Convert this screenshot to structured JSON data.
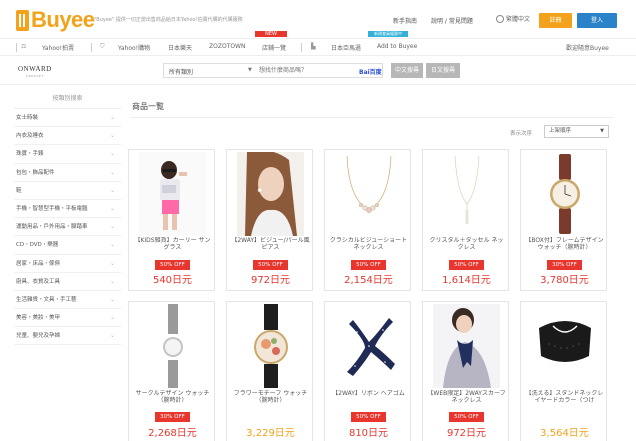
{
  "header": {
    "logo_text": "Buyee",
    "tagline": "\"Buyee\" 提供一切正當出售商品給日本Yahoo!拍賣代購的代購服務",
    "new_badge": "NEW",
    "promo_badge": "新規會員優惠中",
    "link_newbie": "新手指南",
    "link_help": "說明 / 常見問題",
    "language": "繁體中文",
    "signup_button": "註冊",
    "login_button": "登入"
  },
  "nav": {
    "items": [
      "Yahoo!拍賣",
      "Yahoo!購物",
      "日本樂天",
      "ZOZOTOWN",
      "店鋪一覽",
      "日本亞馬遜",
      "Add to Buyee"
    ],
    "right_link": "歡迎隨意Buyee"
  },
  "search": {
    "brand": "ONWARD",
    "brand_sub": "CROSSET",
    "category": "所有類別",
    "placeholder": "想找什麼商品嗎？",
    "logo_text": "Bai百度",
    "btn_cn": "中文搜尋",
    "btn_jp": "日文搜尋"
  },
  "sidebar": {
    "title": "按類別搜索",
    "categories": [
      "女士時裝",
      "內衣及睡衣",
      "珠寶・手錶",
      "包包・飾品配件",
      "鞋",
      "手機・智慧型手機・平板電腦",
      "運動用品・戶外用品・腳踏車",
      "CD・DVD・樂器",
      "居家・床品・傢俱",
      "廚具、衣質及工具",
      "生活雜貨・文具・手工藝",
      "美容・美妝・美甲",
      "兒童、嬰兒及孕婦"
    ]
  },
  "main": {
    "title": "商品一覧",
    "sort_label": "表示次序",
    "sort_value": "上架順序",
    "products": [
      {
        "name": "【KIDS雑貨】カーリー サングラス",
        "badge": "50% OFF",
        "price": "540日元"
      },
      {
        "name": "【2WAY】ビジュー/パール風 ピアス",
        "badge": "50% OFF",
        "price": "972日元"
      },
      {
        "name": "クラシカルビジューショート ネックレス",
        "badge": "50% OFF",
        "price": "2,154日元"
      },
      {
        "name": "クリスタル＋タッセル ネックレス",
        "badge": "50% OFF",
        "price": "1,614日元"
      },
      {
        "name": "【BOX付】フレームデザイン ウォッチ（腕時計）",
        "badge": "30% OFF",
        "price": "3,780日元"
      },
      {
        "name": "サークルデザイン ウォッチ（腕時計）",
        "badge": "30% OFF",
        "price": "2,268日元"
      },
      {
        "name": "フラワーモチーフ ウォッチ（腕時計）",
        "badge": "",
        "price": "3,229日元"
      },
      {
        "name": "【2WAY】リボン ヘアゴム",
        "badge": "50% OFF",
        "price": "810日元"
      },
      {
        "name": "【WEB限定】2WAYスカーフ ネックレス",
        "badge": "50% OFF",
        "price": "972日元"
      },
      {
        "name": "【洗える】スタンドネックレイヤードカラー（つけ",
        "badge": "",
        "price": "3,564日元"
      }
    ]
  },
  "colors": {
    "brand_orange": "#f2a31b",
    "login_blue": "#2a82c9",
    "sale_red": "#e8362f"
  }
}
